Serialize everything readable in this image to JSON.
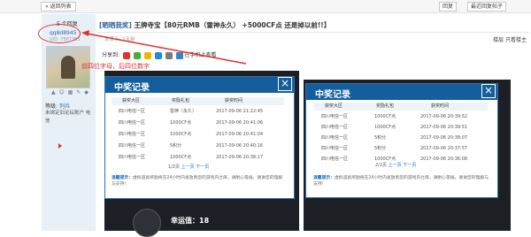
{
  "topbar": {
    "back_label": "« 返回列表",
    "btn_reply": "回复",
    "btn_newest_reply": "最近回复帖子"
  },
  "sidebar": {
    "reply_count": "5 个回复",
    "username": "qq8d8945",
    "username_sub": "UID: 7567355",
    "icons_row": "▲ ☺ ▦ ✎ ◆",
    "level_label": "等级:",
    "level_value": "列兵",
    "unbound_text": "未绑定旧论坛账户 电信"
  },
  "post": {
    "title_tag": "[晒晒我奖]",
    "title_text": " 王牌寺宝【80元RMB（雷神永久） +5000CF点 还是掉以前!!】",
    "date": "发表于: 2天前",
    "meta_right": "楼层 只看楼主",
    "share_label": "分享到:",
    "share_mobile": "在手机上查看"
  },
  "annotation": {
    "text": "前四位字母，后四位数字"
  },
  "popup_left": {
    "title": "中奖记录",
    "close_icon": "×",
    "headers": [
      "获奖大区",
      "奖励礼包",
      "获奖时间"
    ],
    "rows": [
      [
        "四川电信一区",
        "雷神（永久）",
        "2017-09-06 21:22:45"
      ],
      [
        "四川电信一区",
        "1000CF点",
        "2017-09-06 20:41:06"
      ],
      [
        "四川电信一区",
        "1000CF点",
        "2017-09-06 20:41:04"
      ],
      [
        "四川电信一区",
        "5积分",
        "2017-09-06 20:40:16"
      ],
      [
        "四川电信一区",
        "1000CF点",
        "2017-09-06 20:38:17"
      ]
    ],
    "pager_info": "1/2页",
    "pager_prev": "上一页",
    "pager_next": "下一页",
    "notice_label": "温馨提示：",
    "notice_text": "虚拟道具奖励将在24小时内发放到您的游戏内仓库，请耐心等候，谢谢您的理解与支持！"
  },
  "popup_right": {
    "title": "中奖记录",
    "close_icon": "×",
    "headers": [
      "获奖大区",
      "奖励礼包",
      "获奖时间"
    ],
    "rows": [
      [
        "四川电信一区",
        "1000CF点",
        "2017-09-06 20:39:52"
      ],
      [
        "四川电信一区",
        "1000CF点",
        "2017-09-06 20:39:51"
      ],
      [
        "四川电信一区",
        "5积分",
        "2017-09-06 20:38:07"
      ],
      [
        "四川电信一区",
        "5积分",
        "2017-09-06 20:37:57"
      ],
      [
        "四川电信一区",
        "1000CF点",
        "2017-09-06 20:36:08"
      ]
    ],
    "pager_info": "2/2页",
    "pager_prev": "上一页",
    "pager_next": "下一页",
    "notice_label": "温馨提示：",
    "notice_text": "虚拟道具奖励将在24小时内发放到您的游戏内仓库，请耐心等候，谢谢您的理解与支持！"
  },
  "background": {
    "luck_text": "幸运值：18"
  },
  "colors": {
    "header_blue": "#155e9e",
    "annotation_red": "#e03030",
    "link_blue": "#1a6bc0"
  }
}
